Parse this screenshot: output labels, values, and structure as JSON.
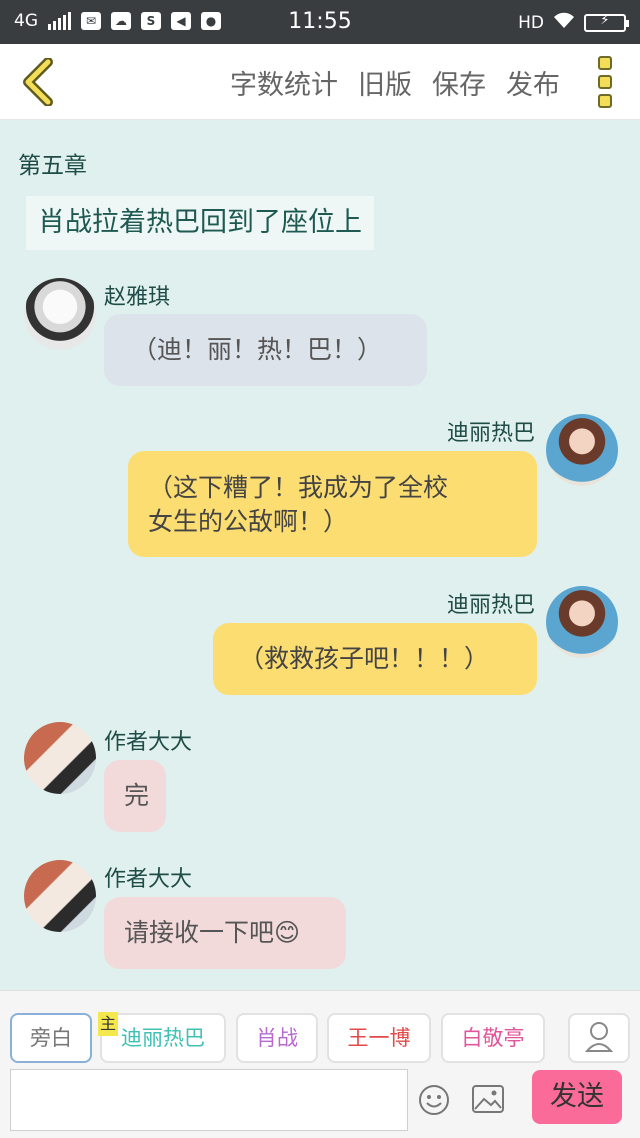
{
  "status_bar": {
    "network": "4G",
    "time": "11:55",
    "hd": "HD",
    "app_icon_label": "S"
  },
  "toolbar": {
    "back_icon": "chevron-left-icon",
    "actions": [
      "字数统计",
      "旧版",
      "保存",
      "发布"
    ],
    "more_icon": "more-vertical-icon",
    "accent": "#f3dd59"
  },
  "chapter": {
    "title": "第五章"
  },
  "narration": {
    "text": "肖战拉着热巴回到了座位上"
  },
  "messages": [
    {
      "name": "赵雅琪",
      "lines": [
        "（迪！丽！热！巴！）"
      ],
      "side": "left",
      "bubble_color": "#dde3ea"
    },
    {
      "name": "迪丽热巴",
      "lines": [
        "（这下糟了！我成为了全校",
        "女生的公敌啊！）"
      ],
      "side": "right",
      "bubble_color": "#fcdd71"
    },
    {
      "name": "迪丽热巴",
      "lines": [
        "（救救孩子吧！！！）"
      ],
      "side": "right",
      "bubble_color": "#fcdd71"
    },
    {
      "name": "作者大大",
      "lines": [
        "完"
      ],
      "side": "left",
      "bubble_color": "#f2dadb"
    },
    {
      "name": "作者大大",
      "lines": [
        "请接收一下吧"
      ],
      "side": "left",
      "bubble_color": "#f2dadb",
      "emoji": "😊"
    }
  ],
  "roles": [
    {
      "label": "旁白",
      "color": "#777777"
    },
    {
      "label": "迪丽热巴",
      "color": "#3fc1b4",
      "tag": "主"
    },
    {
      "label": "肖战",
      "color": "#b76ad0"
    },
    {
      "label": "王一博",
      "color": "#e04a4a"
    },
    {
      "label": "白敬亭",
      "color": "#e0569a"
    }
  ],
  "compose": {
    "send_label": "发送",
    "send_color": "#fb6b9a",
    "emoji_icon": "smiley-icon",
    "image_icon": "image-icon",
    "user_icon": "user-icon"
  }
}
